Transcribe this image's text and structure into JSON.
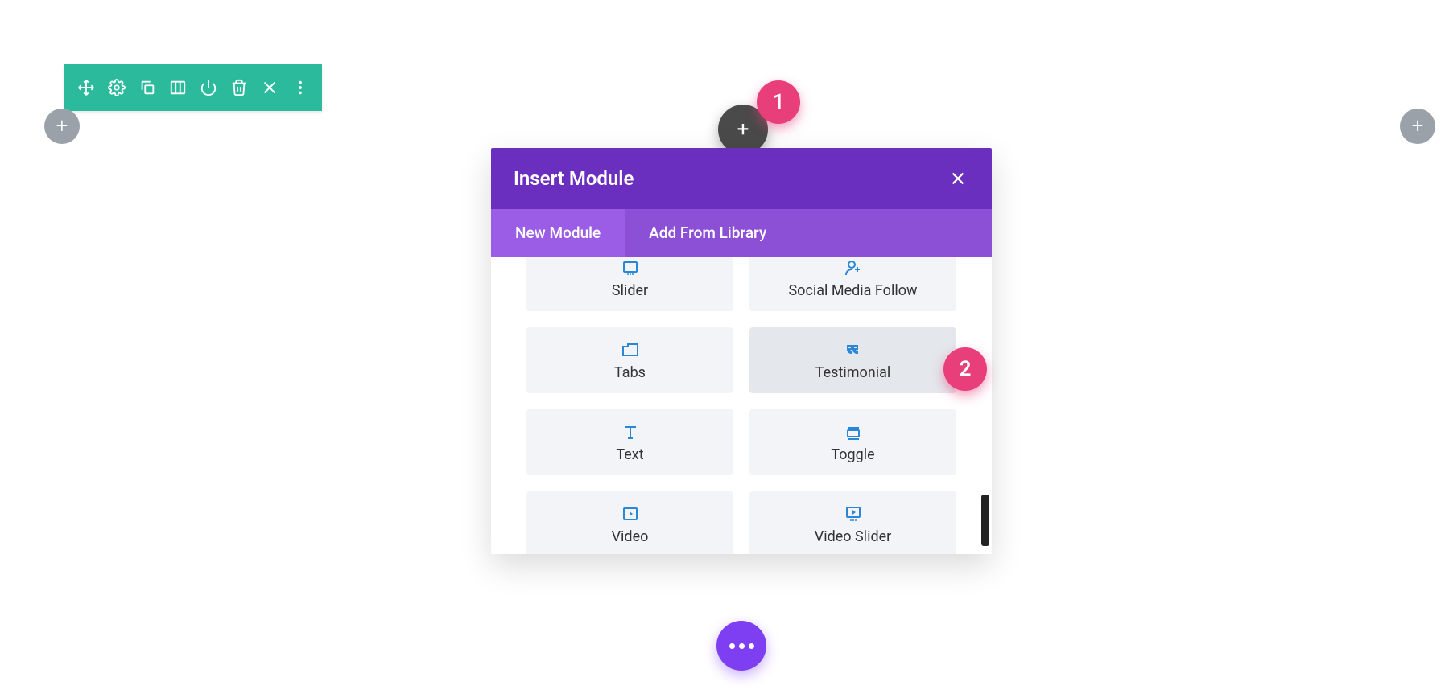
{
  "annotations": {
    "badge1": "1",
    "badge2": "2"
  },
  "modal": {
    "title": "Insert Module",
    "tabs": {
      "new_module": "New Module",
      "add_from_library": "Add From Library"
    },
    "modules": {
      "slider": "Slider",
      "social": "Social Media Follow",
      "tabs": "Tabs",
      "testimonial": "Testimonial",
      "text": "Text",
      "toggle": "Toggle",
      "video": "Video",
      "video_slider": "Video Slider"
    }
  }
}
